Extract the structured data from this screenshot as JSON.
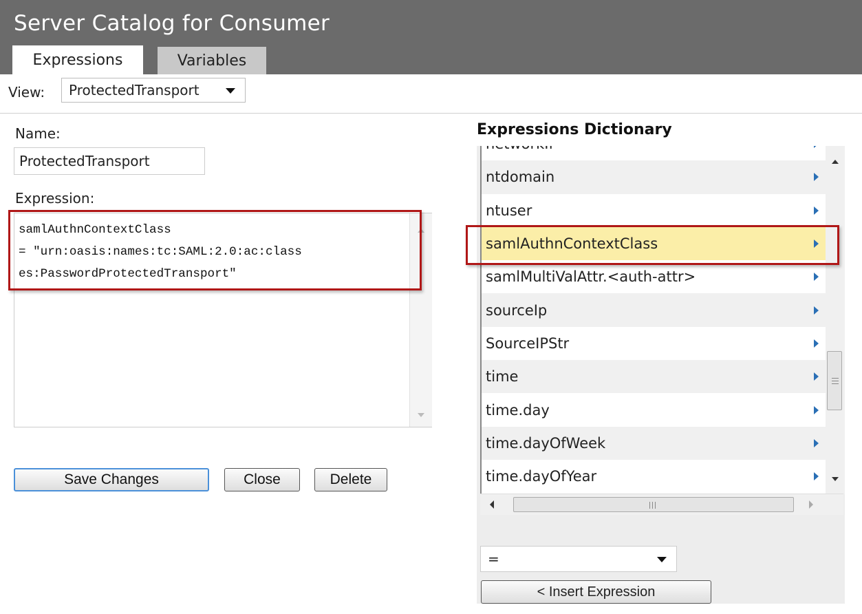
{
  "header": {
    "title": "Server Catalog for Consumer"
  },
  "tabs": [
    {
      "label": "Expressions",
      "active": true
    },
    {
      "label": "Variables",
      "active": false
    }
  ],
  "view": {
    "label": "View:",
    "selected": "ProtectedTransport"
  },
  "form": {
    "name_label": "Name:",
    "name_value": "ProtectedTransport",
    "expression_label": "Expression:",
    "expression_lines": [
      "samlAuthnContextClass",
      "= \"urn:oasis:names:tc:SAML:2.0:ac:class",
      "es:PasswordProtectedTransport\""
    ]
  },
  "buttons": {
    "save": "Save Changes",
    "close": "Close",
    "delete": "Delete"
  },
  "dictionary": {
    "title": "Expressions Dictionary",
    "items": [
      "networkIf",
      "ntdomain",
      "ntuser",
      "samlAuthnContextClass",
      "samlMultiValAttr.<auth-attr>",
      "sourceIp",
      "SourceIPStr",
      "time",
      "time.day",
      "time.dayOfWeek",
      "time.dayOfYear"
    ],
    "selected_item": "samlAuthnContextClass",
    "operator": "=",
    "insert_label": "< Insert Expression"
  },
  "colors": {
    "header_bg": "#6b6b6b",
    "selected_row": "#fbeea8",
    "highlight_border": "#b01717",
    "chevron": "#2a6fb5"
  }
}
